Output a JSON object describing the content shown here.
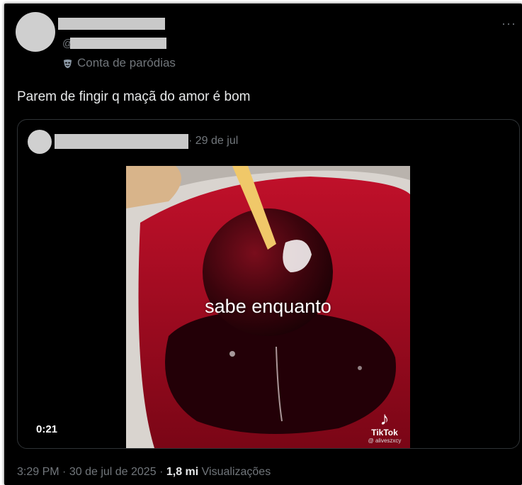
{
  "tweet": {
    "handle_prefix": "@",
    "badge_label": "Conta de paródias",
    "text": "Parem de fingir q maçã do amor é bom",
    "more_label": "···"
  },
  "quoted": {
    "date": "· 29 de jul",
    "video": {
      "caption": "sabe enquanto",
      "duration": "0:21",
      "watermark_name": "TikTok",
      "watermark_user": "@ aliveszxcy"
    }
  },
  "footer": {
    "time": "3:29 PM",
    "sep1": "·",
    "date": "30 de jul de 2025",
    "sep2": "·",
    "views_count": "1,8 mi",
    "views_label": "Visualizações"
  },
  "colors": {
    "background": "#000000",
    "text_primary": "#e7e9ea",
    "text_secondary": "#71767b",
    "border": "#2f3336"
  }
}
